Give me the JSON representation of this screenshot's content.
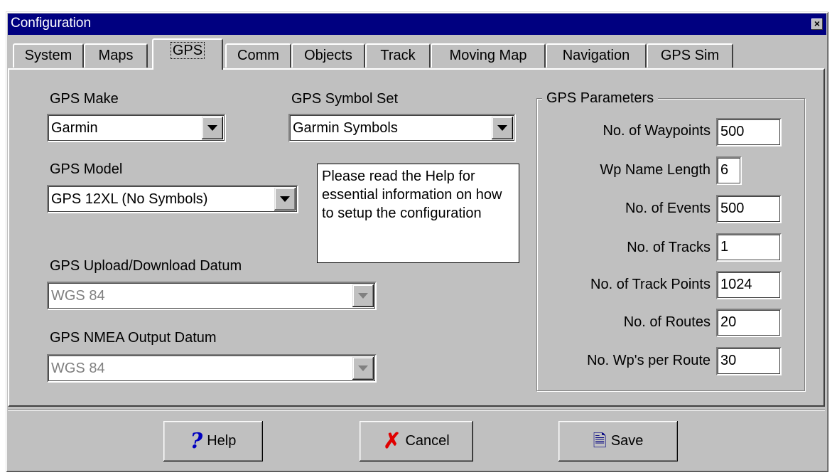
{
  "window": {
    "title": "Configuration",
    "close_glyph": "×"
  },
  "tabs": [
    {
      "label": "System"
    },
    {
      "label": "Maps"
    },
    {
      "label": "GPS"
    },
    {
      "label": "Comm"
    },
    {
      "label": "Objects"
    },
    {
      "label": "Track"
    },
    {
      "label": "Moving Map"
    },
    {
      "label": "Navigation"
    },
    {
      "label": "GPS Sim"
    }
  ],
  "active_tab": "GPS",
  "gps": {
    "make_label": "GPS Make",
    "make_value": "Garmin",
    "symbol_set_label": "GPS Symbol Set",
    "symbol_set_value": "Garmin Symbols",
    "model_label": "GPS Model",
    "model_value": "GPS 12XL (No Symbols)",
    "note": "Please read the Help for essential information on how to setup the configuration",
    "upload_datum_label": "GPS Upload/Download Datum",
    "upload_datum_value": "WGS 84",
    "nmea_datum_label": "GPS NMEA Output Datum",
    "nmea_datum_value": "WGS 84"
  },
  "params": {
    "group_title": "GPS Parameters",
    "waypoints_label": "No. of Waypoints",
    "waypoints_value": "500",
    "wp_name_len_label": "Wp Name Length",
    "wp_name_len_value": "6",
    "events_label": "No. of Events",
    "events_value": "500",
    "tracks_label": "No. of Tracks",
    "tracks_value": "1",
    "track_points_label": "No. of Track Points",
    "track_points_value": "1024",
    "routes_label": "No. of Routes",
    "routes_value": "20",
    "wps_per_route_label": "No. Wp's per Route",
    "wps_per_route_value": "30"
  },
  "buttons": {
    "help_label": "Help",
    "help_icon": "?",
    "cancel_label": "Cancel",
    "cancel_icon": "✗",
    "save_label": "Save",
    "save_icon": "🗎"
  },
  "colors": {
    "titlebar": "#000080",
    "face": "#c0c0c0"
  }
}
